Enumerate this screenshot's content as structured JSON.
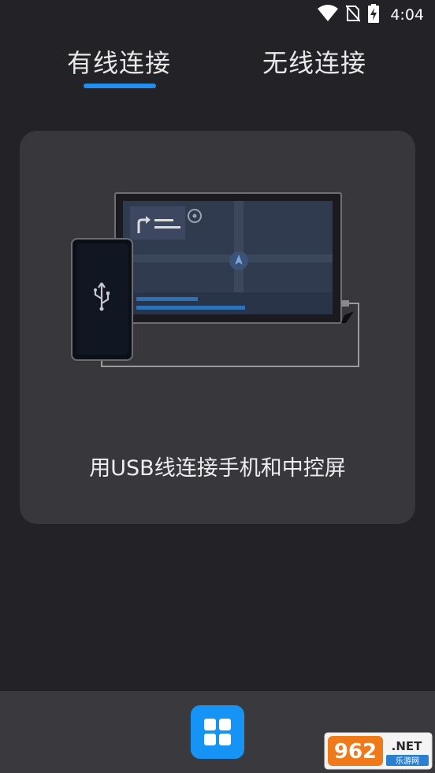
{
  "status_bar": {
    "time": "4:04",
    "icons": [
      "wifi-icon",
      "no-sim-icon",
      "battery-charging-icon"
    ]
  },
  "tabs": [
    {
      "label": "有线连接",
      "selected": true
    },
    {
      "label": "无线连接",
      "selected": false
    }
  ],
  "card": {
    "caption": "用USB线连接手机和中控屏",
    "illustration": "phone-usb-to-car-display"
  },
  "bottom_bar": {
    "icon": "grid-icon"
  },
  "watermark": {
    "text_main": "962.NET",
    "text_sub": "乐游网"
  },
  "colors": {
    "accent": "#1f8ff2",
    "background": "#232226",
    "card": "#38373c",
    "bottom_bar": "#3a393d"
  }
}
